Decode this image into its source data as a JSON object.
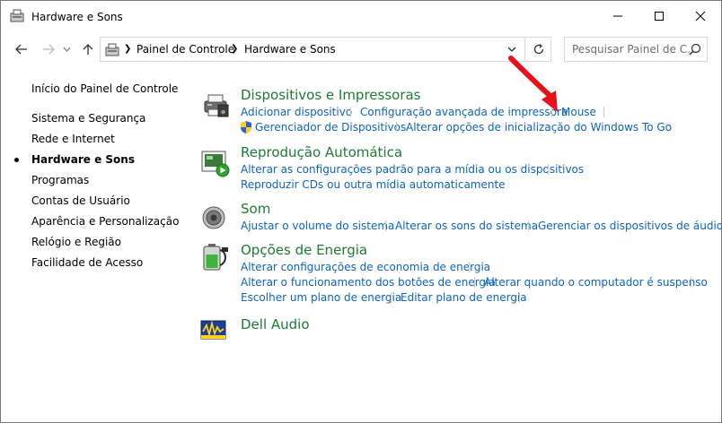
{
  "window": {
    "title": "Hardware e Sons"
  },
  "navbar": {
    "breadcrumb": [
      "Painel de Controle",
      "Hardware e Sons"
    ],
    "search_placeholder": "Pesquisar Painel de C..."
  },
  "leftnav": {
    "home": "Início do Painel de Controle",
    "items": [
      {
        "label": "Sistema e Segurança",
        "active": false
      },
      {
        "label": "Rede e Internet",
        "active": false
      },
      {
        "label": "Hardware e Sons",
        "active": true
      },
      {
        "label": "Programas",
        "active": false
      },
      {
        "label": "Contas de Usuário",
        "active": false
      },
      {
        "label": "Aparência e Personalização",
        "active": false
      },
      {
        "label": "Relógio e Região",
        "active": false
      },
      {
        "label": "Facilidade de Acesso",
        "active": false
      }
    ]
  },
  "categories": [
    {
      "title": "Dispositivos e Impressoras",
      "icon": "printer-icon",
      "links": [
        "Adicionar dispositivo",
        "Configuração avançada de impressora",
        "Mouse",
        "Gerenciador de Dispositivos",
        "Alterar opções de inicialização do Windows To Go"
      ]
    },
    {
      "title": "Reprodução Automática",
      "icon": "autoplay-icon",
      "links": [
        "Alterar as configurações padrão para a mídia ou os dispositivos",
        "Reproduzir CDs ou outra mídia automaticamente"
      ]
    },
    {
      "title": "Som",
      "icon": "speaker-icon",
      "links": [
        "Ajustar o volume do sistema",
        "Alterar os sons do sistema",
        "Gerenciar os dispositivos de áudio"
      ]
    },
    {
      "title": "Opções de Energia",
      "icon": "power-battery-icon",
      "links": [
        "Alterar configurações de economia de energia",
        "Alterar o funcionamento dos botões de energia",
        "Alterar quando o computador é suspenso",
        "Escolher um plano de energia",
        "Editar plano de energia"
      ]
    },
    {
      "title": "Dell Audio",
      "icon": "dell-audio-icon",
      "links": []
    }
  ],
  "colors": {
    "category_title": "#1e7b34",
    "link": "#0c64c0",
    "annotation_arrow": "#e8101a"
  }
}
